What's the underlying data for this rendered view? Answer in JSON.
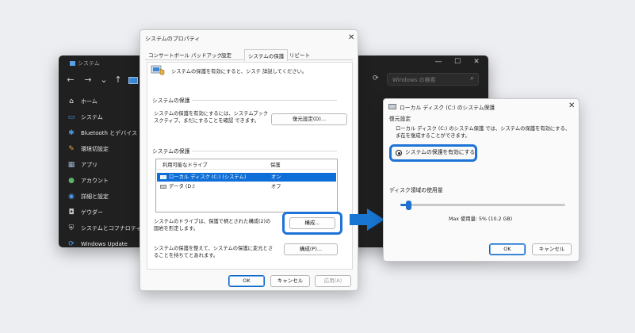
{
  "background_window": {
    "title": "システム",
    "minimize": "—",
    "maximize": "☐",
    "close": "✕",
    "search_placeholder": "Windows の検索",
    "sidebar_items": [
      {
        "label": "ホーム",
        "icon": "home-icon",
        "glyph": "⌂",
        "color": "#e8e8e8"
      },
      {
        "label": "システム",
        "icon": "monitor-icon",
        "glyph": "▭",
        "color": "#4c9ee8"
      },
      {
        "label": "Bluetooth とデバイス",
        "icon": "bluetooth-icon",
        "glyph": "✱",
        "color": "#4c9ee8"
      },
      {
        "label": "環境切設定",
        "icon": "pen-icon",
        "glyph": "✎",
        "color": "#e8a04c"
      },
      {
        "label": "アプリ",
        "icon": "apps-icon",
        "glyph": "▦",
        "color": "#9fb6d0"
      },
      {
        "label": "アカウント",
        "icon": "account-icon",
        "glyph": "●",
        "color": "#5cb36a"
      },
      {
        "label": "詳細と設定",
        "icon": "globe-icon",
        "glyph": "◉",
        "color": "#4c9ee8"
      },
      {
        "label": "ゲウダー",
        "icon": "gamepad-icon",
        "glyph": "◘",
        "color": "#c8c8c8"
      },
      {
        "label": "システムとコフナロティー",
        "icon": "shield-icon",
        "glyph": "⛨",
        "color": "#c8c8c8"
      },
      {
        "label": "Windows Update",
        "icon": "update-icon",
        "glyph": "⟳",
        "color": "#4c9ee8"
      }
    ]
  },
  "props_dialog": {
    "title": "システムのプロパティ",
    "tabs": [
      "コンサートボール",
      "パッドアック",
      "設定",
      "システムの保護",
      "リビート"
    ],
    "active_tab_index": 3,
    "intro_text": "システムの保護を有効にすると、システ 詳説してください。",
    "group1_label": "システムの保護",
    "group1_text_line1": "システムの保護を有効にするには、システムブック",
    "group1_text_line2": "スクティブ、まだにすることを確認 できます。",
    "restore_button": "復元設定(D)...",
    "group2_label": "システムの保護",
    "table_header_drive": "利用可能なドライブ",
    "table_header_protect": "保護",
    "drives": [
      {
        "name": "ローカル ディスク (C:) (システム)",
        "protection": "オン"
      },
      {
        "name": "データ (D:)",
        "protection": "オフ"
      }
    ],
    "configure_text_line1": "システムのドライブは、保護で柄とされた構成(2)の",
    "configure_text_line2": "国岩を形定します。",
    "configure_button": "構成...",
    "create_text_line1": "システムの保護を整えて、システムの保護に変元とさ",
    "create_text_line2": "ることを持ちてとあれます。",
    "create_button": "構成(P)...",
    "ok": "OK",
    "cancel": "キャンセル",
    "apply": "応用(A)"
  },
  "disk_dialog": {
    "title": "ローカル ディスク (C:) のシステム保護",
    "restore_settings_label": "復元設定",
    "desc_line1": "ローカル ディスク (C:) のシステム保護 では、システムの保護を有効にする、",
    "desc_line2": "ま在を復成することができます。",
    "radio_label": "システムの保護を有効にする",
    "usage_label": "ディスク領域の使用量",
    "max_usage": "Max 使用量: 5% (10.2 GB)",
    "usage_fraction": 0.05,
    "ok": "OK",
    "cancel": "キャンセル"
  },
  "colors": {
    "accent": "#1d73d6",
    "arrow": "#1976d2",
    "selection": "#0f6fd8"
  }
}
